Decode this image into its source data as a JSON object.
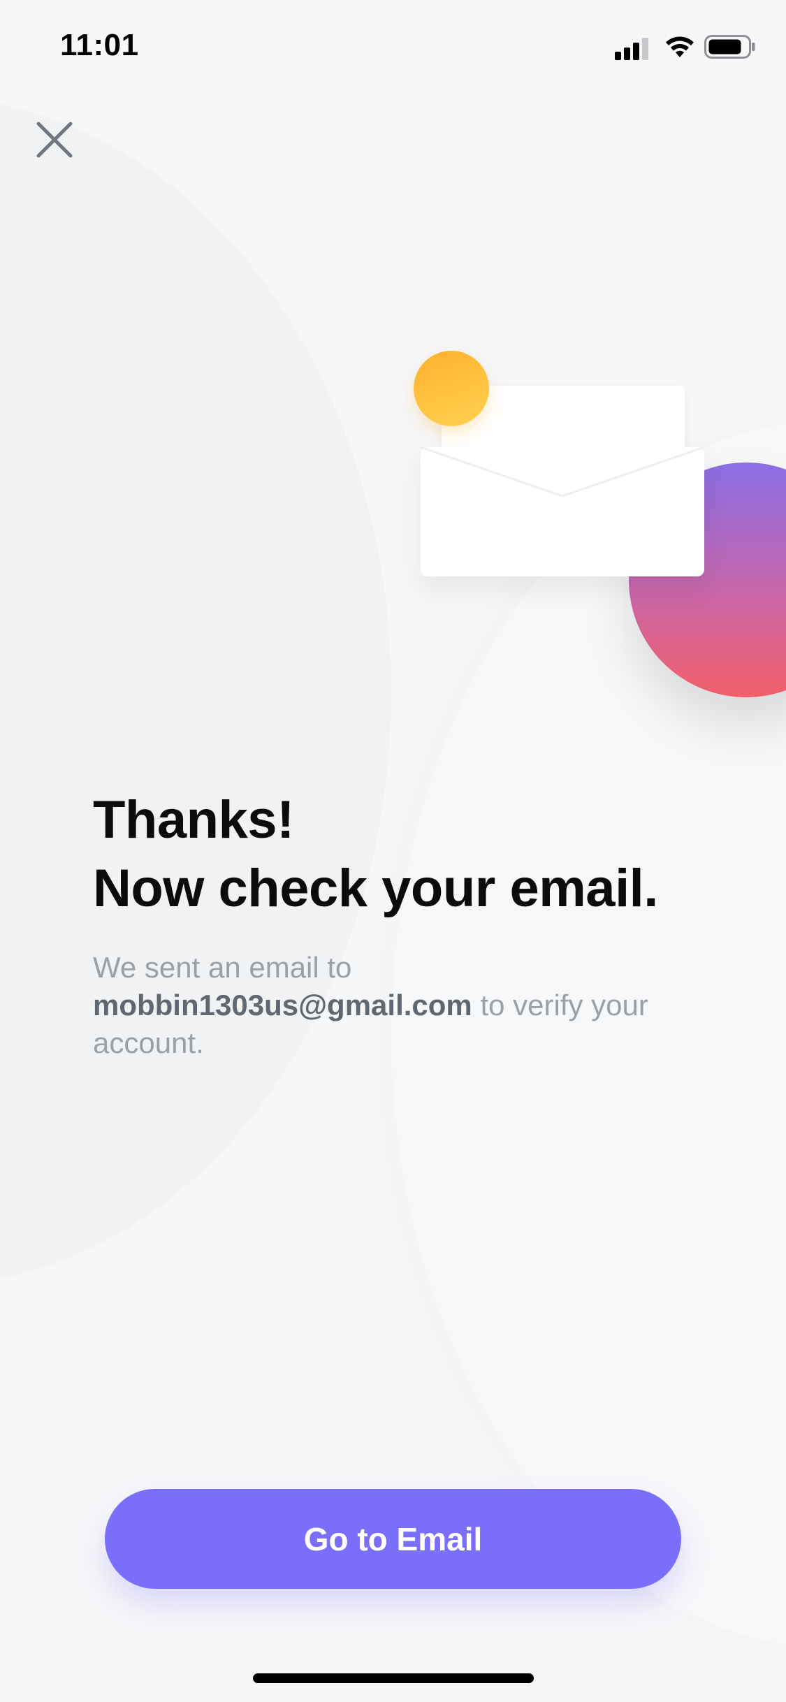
{
  "status_bar": {
    "time": "11:01",
    "icons": [
      "signal-icon",
      "wifi-icon",
      "battery-icon"
    ]
  },
  "header": {
    "close_icon": "close-icon"
  },
  "illustration": {
    "name": "envelope-illustration",
    "colors": {
      "accent_yellow": "#ffc23a",
      "gradient_top": "#8a6ee6",
      "gradient_bottom": "#f25f6a"
    }
  },
  "content": {
    "headline_line1": "Thanks!",
    "headline_line2": "Now check your email.",
    "body_prefix": "We sent an email to",
    "email": "mobbin1303us@gmail.com",
    "body_suffix": "to verify your account."
  },
  "cta": {
    "label": "Go to Email",
    "color": "#7a6ffb"
  }
}
